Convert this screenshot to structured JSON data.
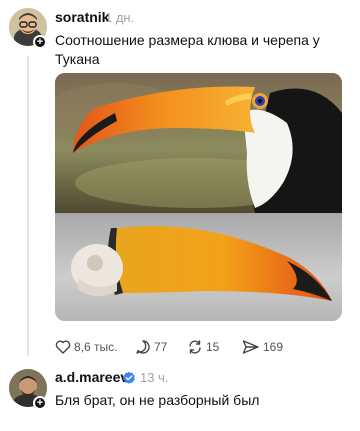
{
  "post": {
    "username": "soratnik",
    "time": "1 дн.",
    "text": "Соотношение размера клюва и черепа у Тукана",
    "image_top_alt": "toucan-photo",
    "image_bottom_alt": "toucan-skull-photo"
  },
  "actions": {
    "likes": "8,6 тыс.",
    "comments": "77",
    "reposts": "15",
    "shares": "169"
  },
  "reply": {
    "username": "a.d.mareev",
    "time": "13 ч.",
    "text": "Бля брат, он не разборный был"
  },
  "icons": {
    "like": "heart-icon",
    "comment": "comment-icon",
    "repost": "repost-icon",
    "share": "share-icon",
    "verified": "verified-badge-icon",
    "follow": "plus-icon"
  },
  "colors": {
    "verified": "#3b82f6",
    "beak_orange": "#f08a1c",
    "muted_text": "#a3a3a3"
  }
}
